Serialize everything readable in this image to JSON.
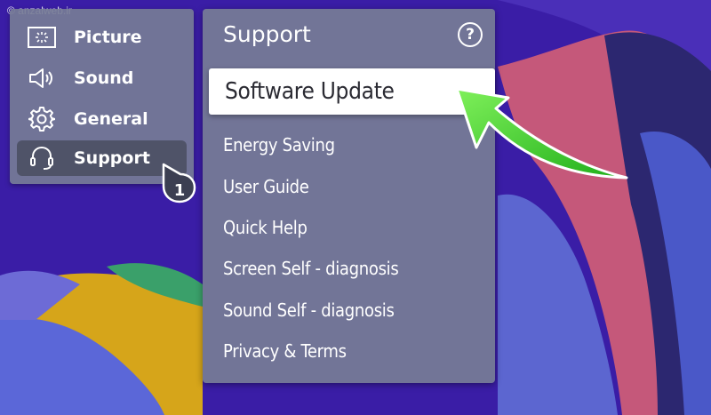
{
  "watermark": "© anzalweb.ir",
  "categories": [
    {
      "label": "Picture",
      "icon": "picture-icon"
    },
    {
      "label": "Sound",
      "icon": "speaker-icon"
    },
    {
      "label": "General",
      "icon": "gear-icon"
    },
    {
      "label": "Support",
      "icon": "headset-icon",
      "active": true
    }
  ],
  "support_menu": {
    "title": "Support",
    "help_icon": "?",
    "items": [
      {
        "label": "Software Update",
        "selected": true
      },
      {
        "label": "Energy Saving"
      },
      {
        "label": "User Guide"
      },
      {
        "label": "Quick Help"
      },
      {
        "label": "Screen Self - diagnosis"
      },
      {
        "label": "Sound Self - diagnosis"
      },
      {
        "label": "Privacy & Terms"
      }
    ]
  },
  "step_badge": "1",
  "colors": {
    "panel": "#767c96",
    "active_item": "#4f5368",
    "arrow": "#3ecf1e",
    "background": "#3a1da6"
  }
}
